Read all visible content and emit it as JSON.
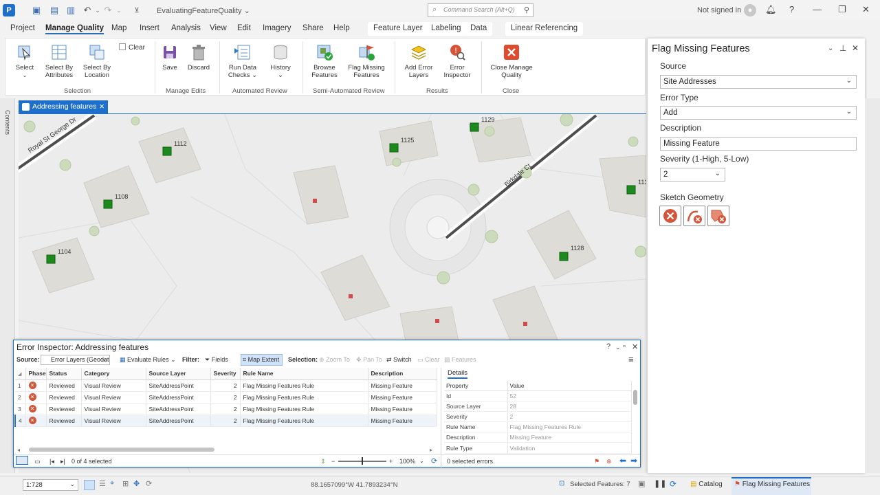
{
  "titlebar": {
    "project_name": "EvaluatingFeatureQuality ⌄",
    "command_search_placeholder": "Command Search (Alt+Q)",
    "sign_in_status": "Not signed in"
  },
  "menu": {
    "tabs": [
      "Project",
      "Manage Quality",
      "Map",
      "Insert",
      "Analysis",
      "View",
      "Edit",
      "Imagery",
      "Share",
      "Help"
    ],
    "contextual_tabs": [
      "Feature Layer",
      "Labeling",
      "Data"
    ],
    "linear_tab": "Linear Referencing"
  },
  "ribbon": {
    "selection": {
      "select": "Select",
      "by_attributes": "Select By\nAttributes",
      "by_location": "Select By\nLocation",
      "clear": "Clear",
      "group": "Selection"
    },
    "manage_edits": {
      "save": "Save",
      "discard": "Discard",
      "group": "Manage Edits"
    },
    "automated_review": {
      "run_data_checks": "Run Data\nChecks ⌄",
      "history": "History\n⌄",
      "group": "Automated Review"
    },
    "semi_automated": {
      "browse": "Browse\nFeatures",
      "flag_missing": "Flag Missing\nFeatures",
      "group": "Semi-Automated Review"
    },
    "results": {
      "add_error_layers": "Add Error\nLayers",
      "error_inspector": "Error\nInspector",
      "group": "Results"
    },
    "close": {
      "close_manage": "Close Manage\nQuality",
      "group": "Close"
    }
  },
  "contents_label": "Contents",
  "map": {
    "tab_label": "Addressing features",
    "streets": [
      "Royal St George Dr",
      "Birkdale Ct"
    ],
    "addresses": [
      "1112",
      "1108",
      "1104",
      "1125",
      "1129",
      "1128",
      "113"
    ]
  },
  "pane": {
    "title": "Flag Missing Features",
    "source_label": "Source",
    "source_value": "Site Addresses",
    "error_type_label": "Error Type",
    "error_type_value": "Add",
    "description_label": "Description",
    "description_value": "Missing Feature",
    "severity_label": "Severity (1-High, 5-Low)",
    "severity_value": "2",
    "sketch_label": "Sketch Geometry"
  },
  "inspector": {
    "title": "Error Inspector: Addressing features",
    "toolbar": {
      "source_label": "Source:",
      "source_value": "Error Layers (Geodat",
      "evaluate_rules": "Evaluate Rules",
      "filter_label": "Filter:",
      "fields": "Fields",
      "map_extent": "Map Extent",
      "selection_label": "Selection:",
      "zoom_to": "Zoom To",
      "pan_to": "Pan To",
      "switch": "Switch",
      "clear": "Clear",
      "features": "Features"
    },
    "columns": [
      "Phase",
      "Status",
      "Category",
      "Source Layer",
      "Severity",
      "Rule Name",
      "Description"
    ],
    "rows": [
      {
        "n": "1",
        "status": "Reviewed",
        "category": "Visual Review",
        "layer": "SiteAddressPoint",
        "severity": "2",
        "rule": "Flag Missing Features Rule",
        "desc": "Missing Feature"
      },
      {
        "n": "2",
        "status": "Reviewed",
        "category": "Visual Review",
        "layer": "SiteAddressPoint",
        "severity": "2",
        "rule": "Flag Missing Features Rule",
        "desc": "Missing Feature"
      },
      {
        "n": "3",
        "status": "Reviewed",
        "category": "Visual Review",
        "layer": "SiteAddressPoint",
        "severity": "2",
        "rule": "Flag Missing Features Rule",
        "desc": "Missing Feature"
      },
      {
        "n": "4",
        "status": "Reviewed",
        "category": "Visual Review",
        "layer": "SiteAddressPoint",
        "severity": "2",
        "rule": "Flag Missing Features Rule",
        "desc": "Missing Feature"
      }
    ],
    "footer_selected": "0 of 4 selected",
    "zoom": "100%",
    "details_tab": "Details",
    "details_columns": [
      "Property",
      "Value"
    ],
    "details": [
      {
        "k": "Id",
        "v": "52"
      },
      {
        "k": "Source Layer",
        "v": "28"
      },
      {
        "k": "Severity",
        "v": "2"
      },
      {
        "k": "Rule Name",
        "v": "Flag Missing Features Rule"
      },
      {
        "k": "Description",
        "v": "Missing Feature"
      },
      {
        "k": "Rule Type",
        "v": "Validation"
      }
    ],
    "details_footer": "0 selected errors."
  },
  "status": {
    "scale": "1:728",
    "coordinates": "88.1657099°W 41.7893234°N",
    "selected_features": "Selected Features: 7",
    "catalog_tab": "Catalog",
    "flag_tab": "Flag Missing Features"
  },
  "colors": {
    "accent": "#1e6fc9",
    "error_red": "#d4553a",
    "feature_green": "#1d8a1d"
  }
}
